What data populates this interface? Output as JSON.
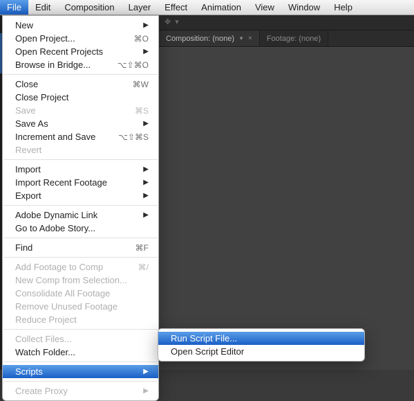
{
  "menubar": {
    "items": [
      {
        "label": "File",
        "active": true
      },
      {
        "label": "Edit"
      },
      {
        "label": "Composition"
      },
      {
        "label": "Layer"
      },
      {
        "label": "Effect"
      },
      {
        "label": "Animation"
      },
      {
        "label": "View"
      },
      {
        "label": "Window"
      },
      {
        "label": "Help"
      }
    ]
  },
  "file_menu": {
    "groups": [
      [
        {
          "label": "New",
          "submenu": true
        },
        {
          "label": "Open Project...",
          "shortcut": "⌘O"
        },
        {
          "label": "Open Recent Projects",
          "submenu": true
        },
        {
          "label": "Browse in Bridge...",
          "shortcut": "⌥⇧⌘O"
        }
      ],
      [
        {
          "label": "Close",
          "shortcut": "⌘W"
        },
        {
          "label": "Close Project"
        },
        {
          "label": "Save",
          "shortcut": "⌘S",
          "disabled": true
        },
        {
          "label": "Save As",
          "submenu": true
        },
        {
          "label": "Increment and Save",
          "shortcut": "⌥⇧⌘S"
        },
        {
          "label": "Revert",
          "disabled": true
        }
      ],
      [
        {
          "label": "Import",
          "submenu": true
        },
        {
          "label": "Import Recent Footage",
          "submenu": true
        },
        {
          "label": "Export",
          "submenu": true
        }
      ],
      [
        {
          "label": "Adobe Dynamic Link",
          "submenu": true
        },
        {
          "label": "Go to Adobe Story..."
        }
      ],
      [
        {
          "label": "Find",
          "shortcut": "⌘F"
        }
      ],
      [
        {
          "label": "Add Footage to Comp",
          "shortcut": "⌘/",
          "disabled": true
        },
        {
          "label": "New Comp from Selection...",
          "disabled": true
        },
        {
          "label": "Consolidate All Footage",
          "disabled": true
        },
        {
          "label": "Remove Unused Footage",
          "disabled": true
        },
        {
          "label": "Reduce Project",
          "disabled": true
        }
      ],
      [
        {
          "label": "Collect Files...",
          "disabled": true
        },
        {
          "label": "Watch Folder..."
        }
      ],
      [
        {
          "label": "Scripts",
          "submenu": true,
          "highlight": true
        }
      ],
      [
        {
          "label": "Create Proxy",
          "submenu": true,
          "disabled": true
        }
      ]
    ]
  },
  "scripts_submenu": {
    "items": [
      {
        "label": "Run Script File...",
        "highlight": true
      },
      {
        "label": "Open Script Editor"
      }
    ]
  },
  "panels": {
    "composition_tab": "Composition: (none)",
    "footage_tab": "Footage: (none)"
  }
}
